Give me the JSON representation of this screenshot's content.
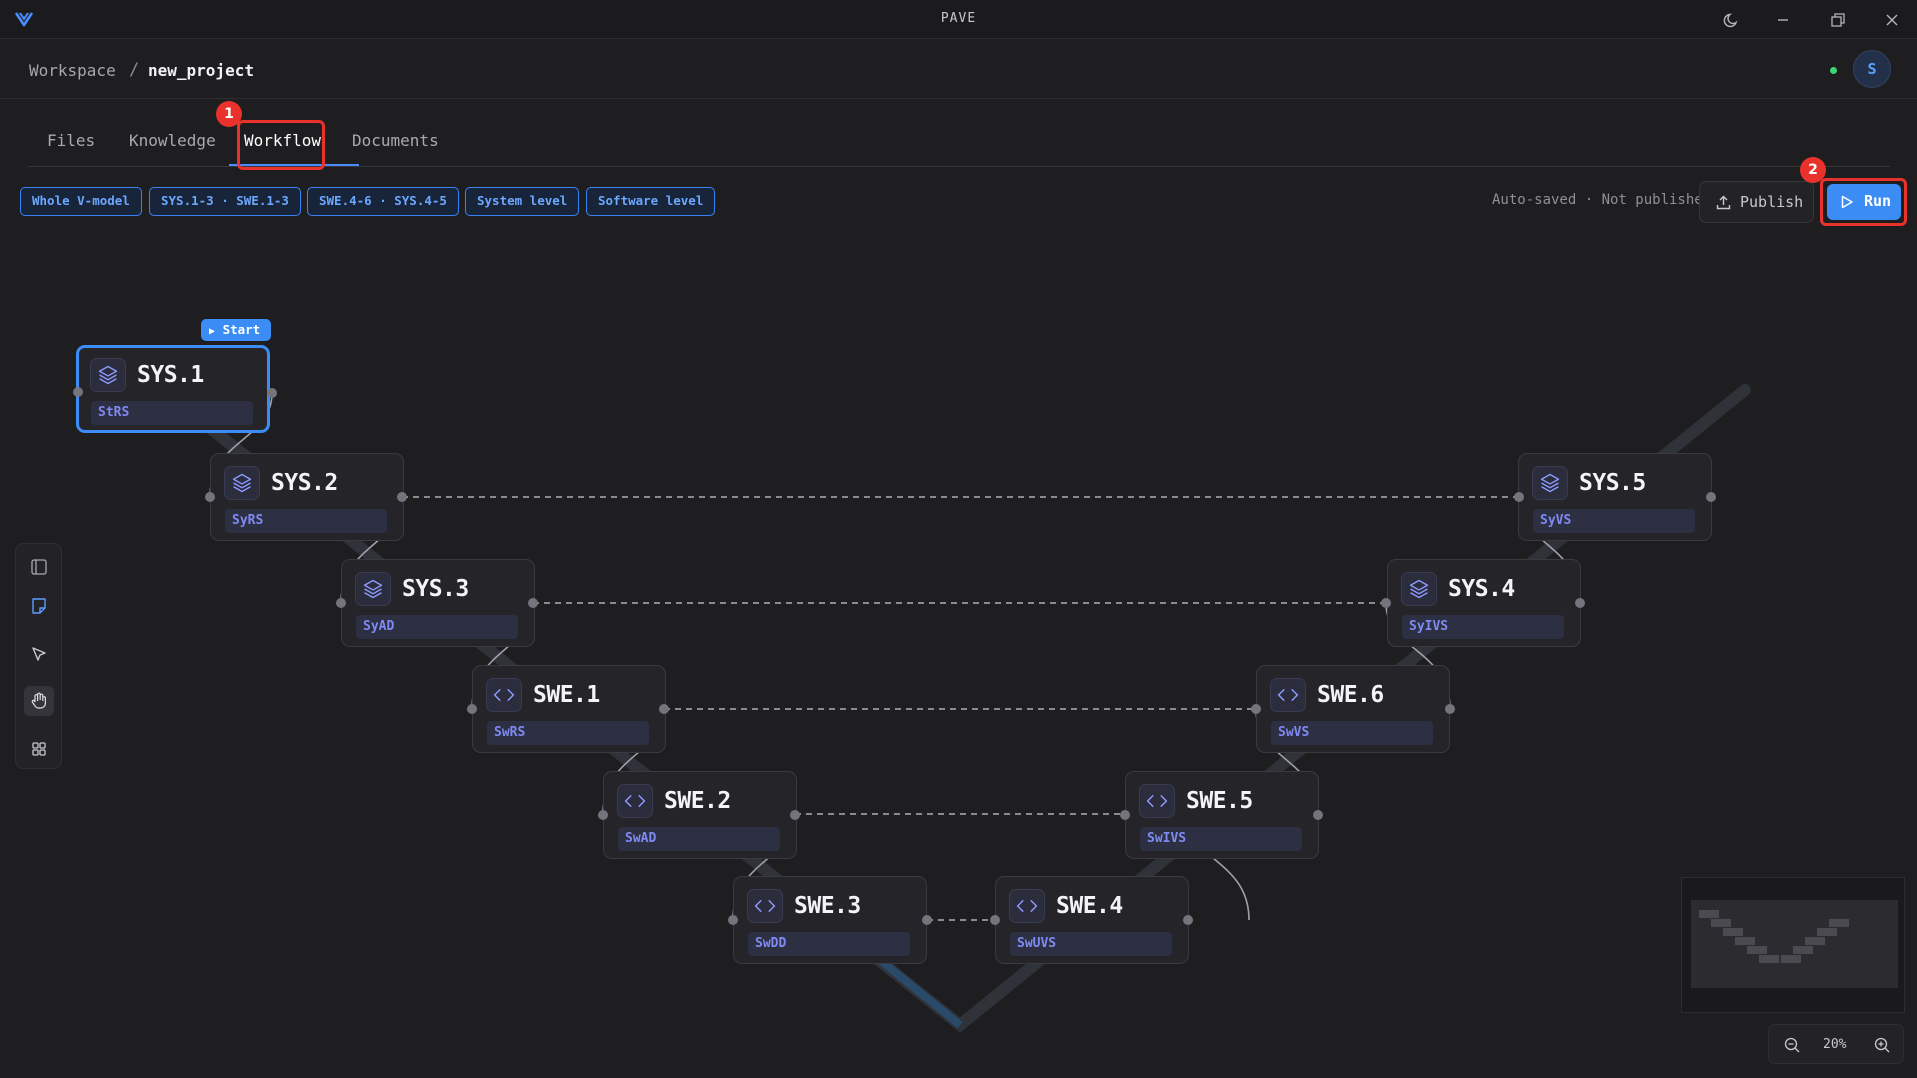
{
  "app": {
    "title": "PAVE"
  },
  "breadcrumb": {
    "workspace": "Workspace",
    "separator": "/",
    "project": "new_project",
    "avatar_initial": "S"
  },
  "tabs": [
    {
      "label": "Files"
    },
    {
      "label": "Knowledge"
    },
    {
      "label": "Workflow",
      "active": true
    },
    {
      "label": "Documents"
    }
  ],
  "annotations": {
    "workflow_tab_badge": "1",
    "run_button_badge": "2"
  },
  "filters": [
    "Whole V-model",
    "SYS.1-3 · SWE.1-3",
    "SWE.4-6 · SYS.4-5",
    "System level",
    "Software level"
  ],
  "toolbar": {
    "status": "Auto-saved · Not published",
    "publish_label": "Publish",
    "run_label": "Run"
  },
  "workflow": {
    "start_label": "Start",
    "nodes": [
      {
        "id": "sys1",
        "title": "SYS.1",
        "subtitle": "StRS",
        "icon": "layers-icon"
      },
      {
        "id": "sys2",
        "title": "SYS.2",
        "subtitle": "SyRS",
        "icon": "layers-icon"
      },
      {
        "id": "sys3",
        "title": "SYS.3",
        "subtitle": "SyAD",
        "icon": "layers-icon"
      },
      {
        "id": "swe1",
        "title": "SWE.1",
        "subtitle": "SwRS",
        "icon": "code-icon"
      },
      {
        "id": "swe2",
        "title": "SWE.2",
        "subtitle": "SwAD",
        "icon": "code-icon"
      },
      {
        "id": "swe3",
        "title": "SWE.3",
        "subtitle": "SwDD",
        "icon": "code-icon"
      },
      {
        "id": "swe4",
        "title": "SWE.4",
        "subtitle": "SwUVS",
        "icon": "code-icon"
      },
      {
        "id": "swe5",
        "title": "SWE.5",
        "subtitle": "SwIVS",
        "icon": "code-icon"
      },
      {
        "id": "swe6",
        "title": "SWE.6",
        "subtitle": "SwVS",
        "icon": "code-icon"
      },
      {
        "id": "sys4",
        "title": "SYS.4",
        "subtitle": "SyIVS",
        "icon": "layers-icon"
      },
      {
        "id": "sys5",
        "title": "SYS.5",
        "subtitle": "SyVS",
        "icon": "layers-icon"
      }
    ]
  },
  "zoom": {
    "value": "20%"
  },
  "colors": {
    "accent": "#3b8df5",
    "highlight": "#e8322b",
    "status_online": "#3bd671",
    "subtitle_text": "#7f8bf2"
  }
}
